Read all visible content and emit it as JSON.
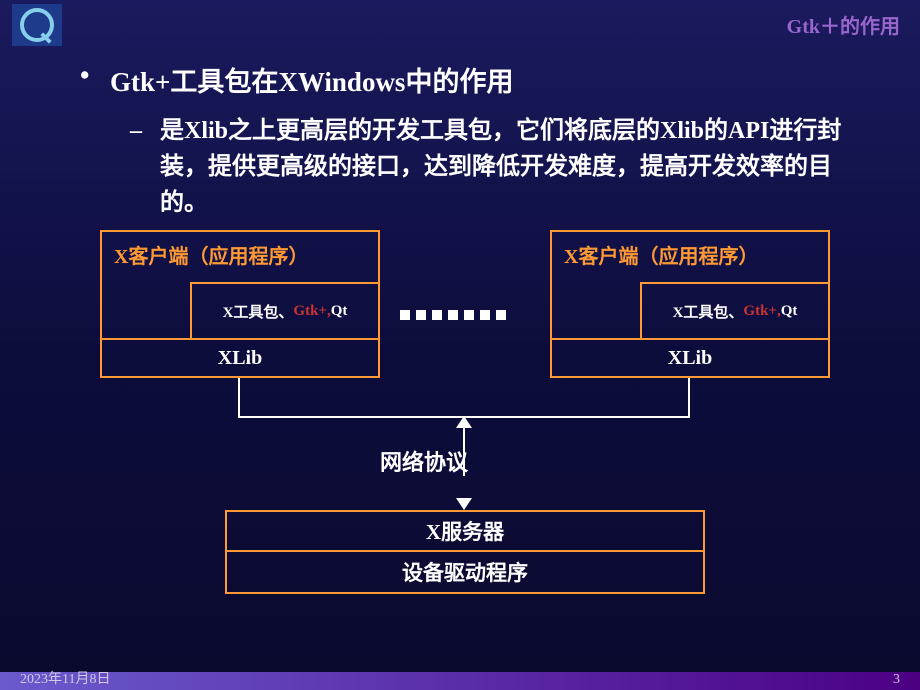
{
  "header": {
    "title": "Gtk＋的作用"
  },
  "content": {
    "main_bullet": "Gtk+工具包在XWindows中的作用",
    "sub_bullet": "是Xlib之上更高层的开发工具包，它们将底层的Xlib的API进行封装，提供更高级的接口，达到降低开发难度，提高开发效率的目的。"
  },
  "diagram": {
    "client_title": "X客户端（应用程序）",
    "toolkit_prefix": "X工具包、",
    "toolkit_gtk": "Gtk+,",
    "toolkit_suffix": "Qt",
    "xlib": "XLib",
    "protocol": "网络协议",
    "server": "X服务器",
    "driver": "设备驱动程序"
  },
  "footer": {
    "date": "2023年11月8日",
    "page": "3"
  }
}
